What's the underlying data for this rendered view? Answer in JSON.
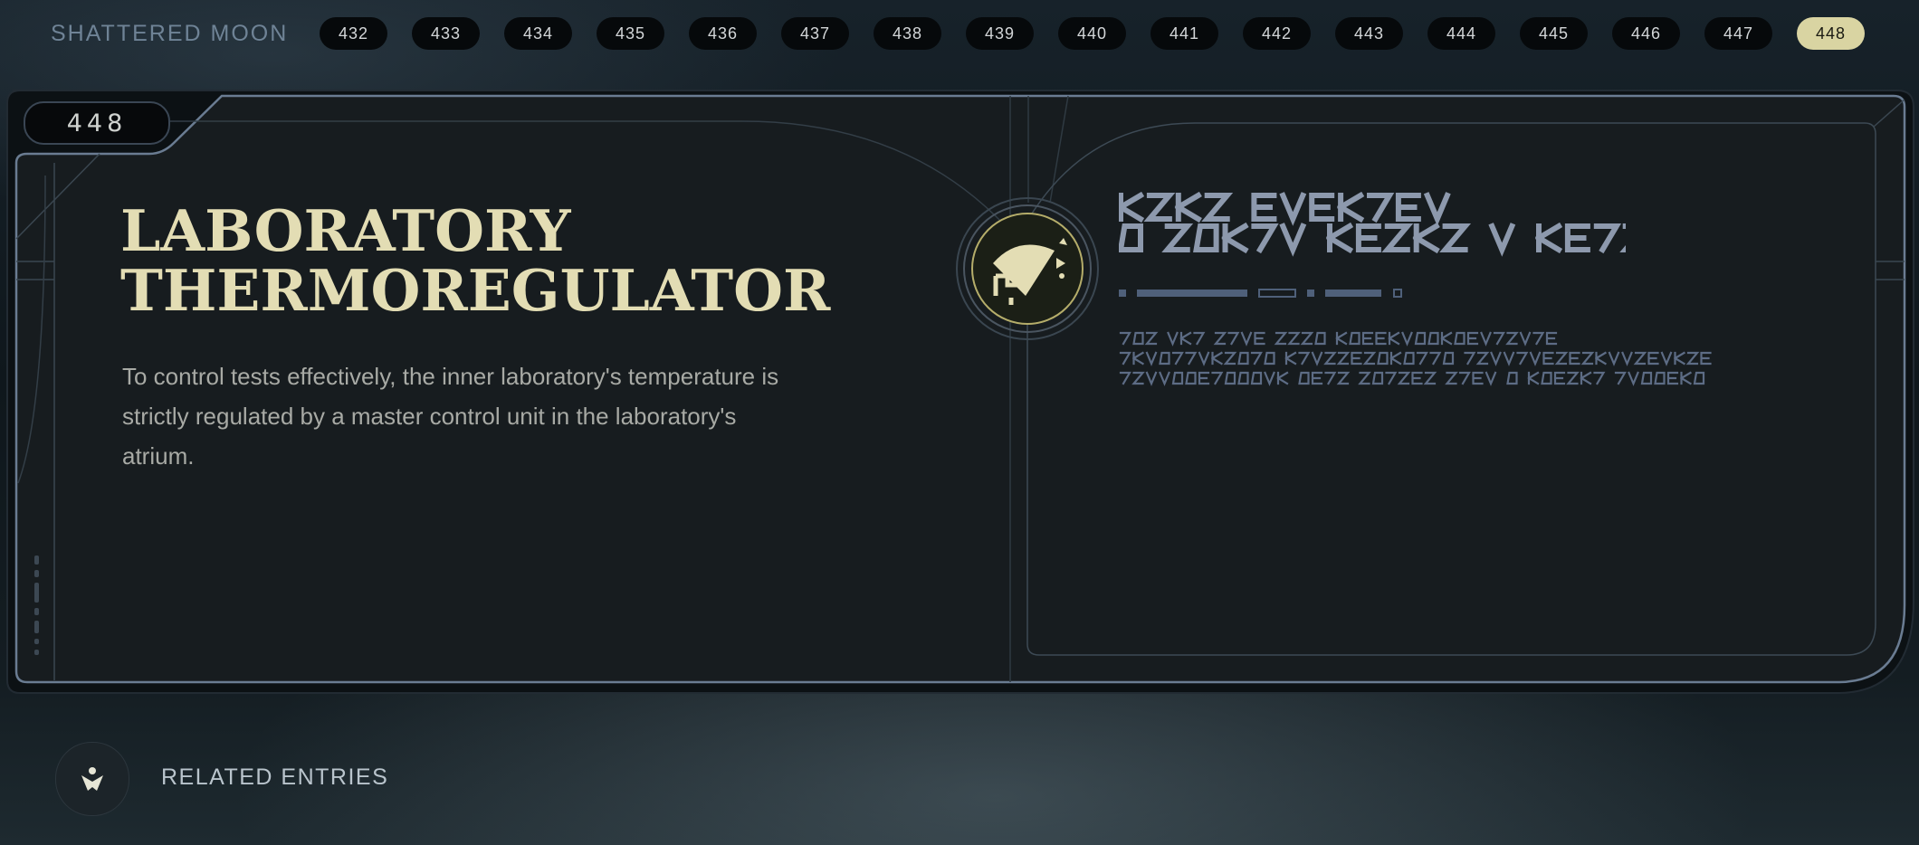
{
  "nav": {
    "brand": "SHATTERED MOON",
    "entries": [
      "432",
      "433",
      "434",
      "435",
      "436",
      "437",
      "438",
      "439",
      "440",
      "441",
      "442",
      "443",
      "444",
      "445",
      "446",
      "447",
      "448"
    ],
    "active": "448"
  },
  "entry": {
    "number": "448",
    "title_line1": "LABORATORY",
    "title_line2": "THERMOREGULATOR",
    "description": "To control tests effectively, the inner laboratory's temperature is strictly regulated by a master control unit in the laboratory's atrium.",
    "emblem_icon": "databank-emblem-icon"
  },
  "related": {
    "label": "RELATED ENTRIES",
    "icon": "related-entries-icon"
  },
  "colors": {
    "accent": "#d9d4a2",
    "title": "#e3ddb4",
    "aurebesh": "#7f8ea6",
    "frame": "#55657a"
  }
}
